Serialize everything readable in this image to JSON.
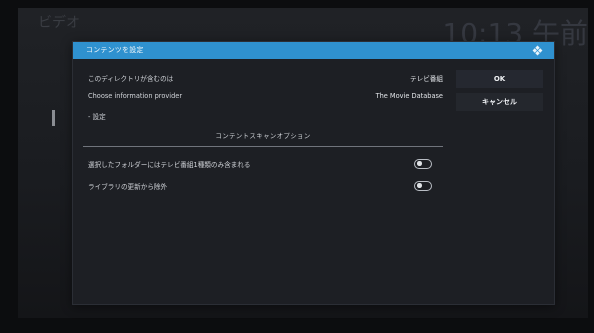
{
  "background": {
    "title": "ビデオ",
    "clock": "10:13 午前"
  },
  "dialog": {
    "title": "コンテンツを設定",
    "rows": [
      {
        "label": "このディレクトリが含むのは",
        "value": "テレビ番組"
      },
      {
        "label": "Choose information provider",
        "value": "The Movie Database"
      },
      {
        "label": "- 設定",
        "value": ""
      }
    ],
    "section_title": "コンテントスキャンオプション",
    "options": [
      {
        "label": "選択したフォルダーにはテレビ番組1種類のみ含まれる",
        "toggle": "off"
      },
      {
        "label": "ライブラリの更新から除外",
        "toggle": "off"
      }
    ],
    "buttons": {
      "ok": "OK",
      "cancel": "キャンセル"
    }
  },
  "colors": {
    "header": "#2f91cf",
    "dialog_bg": "#1d1f24",
    "text": "#d0d3d8"
  }
}
